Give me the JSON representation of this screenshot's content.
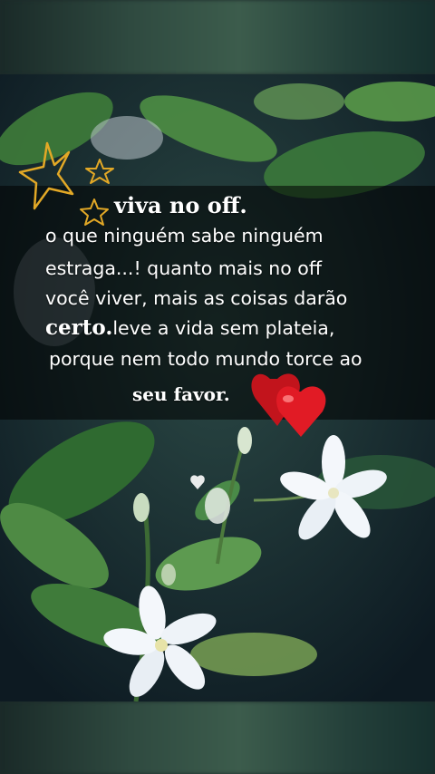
{
  "post": {
    "title": "viva no off.",
    "line1": "o que ninguém sabe ninguém",
    "line2": "estraga...! quanto mais no off",
    "line3": "você viver, mais as coisas darão",
    "line4_bold": "certo.",
    "line4_rest": "leve a vida sem plateia,",
    "line5": "porque nem todo mundo torce ao",
    "line6": "seu favor."
  },
  "decorations": {
    "stars": [
      "star-icon",
      "star-icon",
      "star-icon"
    ],
    "hearts": [
      "heart-icon",
      "heart-icon",
      "heart-icon"
    ],
    "star_color": "#e2a826",
    "heart_color": "#d81b22"
  }
}
